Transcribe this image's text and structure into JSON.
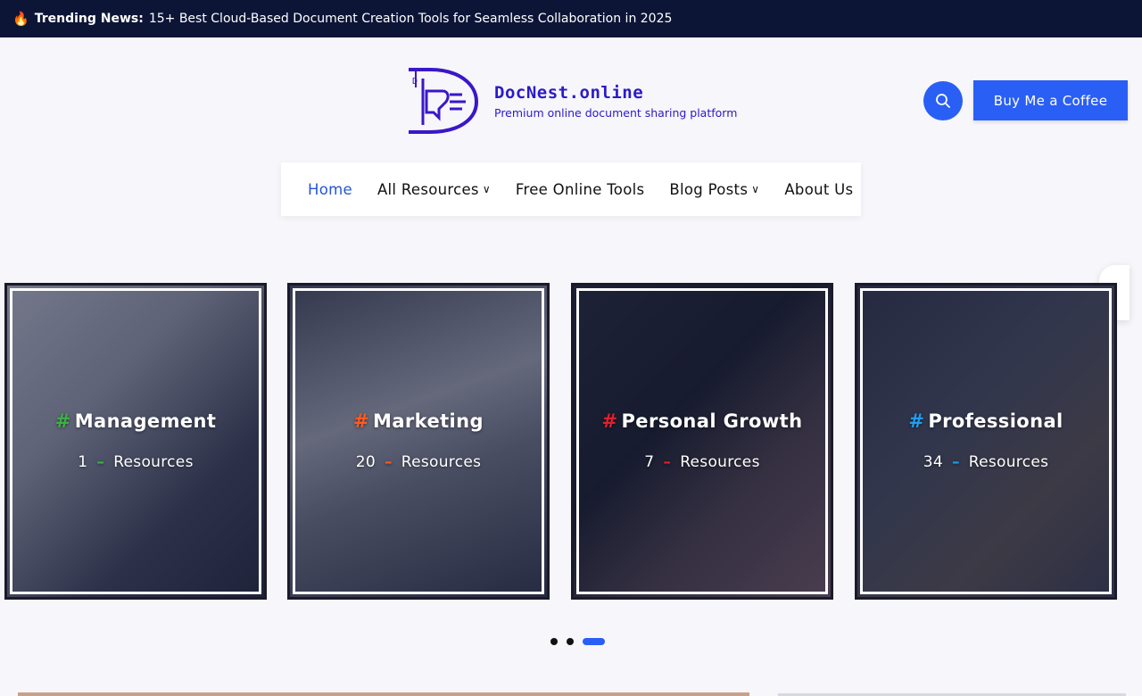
{
  "topbar": {
    "icon": "flame-icon",
    "label": "Trending News:",
    "headline": "15+ Best Cloud-Based Document Creation Tools for Seamless Collaboration in 2025"
  },
  "header": {
    "site_title": "DocNest.online",
    "tagline": "Premium online document sharing platform",
    "search_icon": "search-icon",
    "coffee_label": "Buy Me a Coffee"
  },
  "nav": {
    "items": [
      {
        "label": "Home",
        "active": true
      },
      {
        "label": "All Resources",
        "dropdown": true
      },
      {
        "label": "Free Online Tools"
      },
      {
        "label": "Blog Posts",
        "dropdown": true
      },
      {
        "label": "About Us"
      }
    ]
  },
  "dark_mode": {
    "icon": "moon-icon"
  },
  "categories": [
    {
      "name": "Management",
      "count": "1",
      "suffix": "Resources",
      "accent": "#3cb043"
    },
    {
      "name": "Marketing",
      "count": "20",
      "suffix": "Resources",
      "accent": "#ff5a1f"
    },
    {
      "name": "Personal Growth",
      "count": "7",
      "suffix": "Resources",
      "accent": "#e0202e"
    },
    {
      "name": "Professional",
      "count": "34",
      "suffix": "Resources",
      "accent": "#1e9ef0"
    }
  ],
  "carousel": {
    "pages": 3,
    "active_page": 3
  },
  "colors": {
    "topbar": "#0c1536",
    "brand": "#2b1ac9",
    "primary": "#2a5ff5",
    "nav_active": "#2455d6"
  }
}
